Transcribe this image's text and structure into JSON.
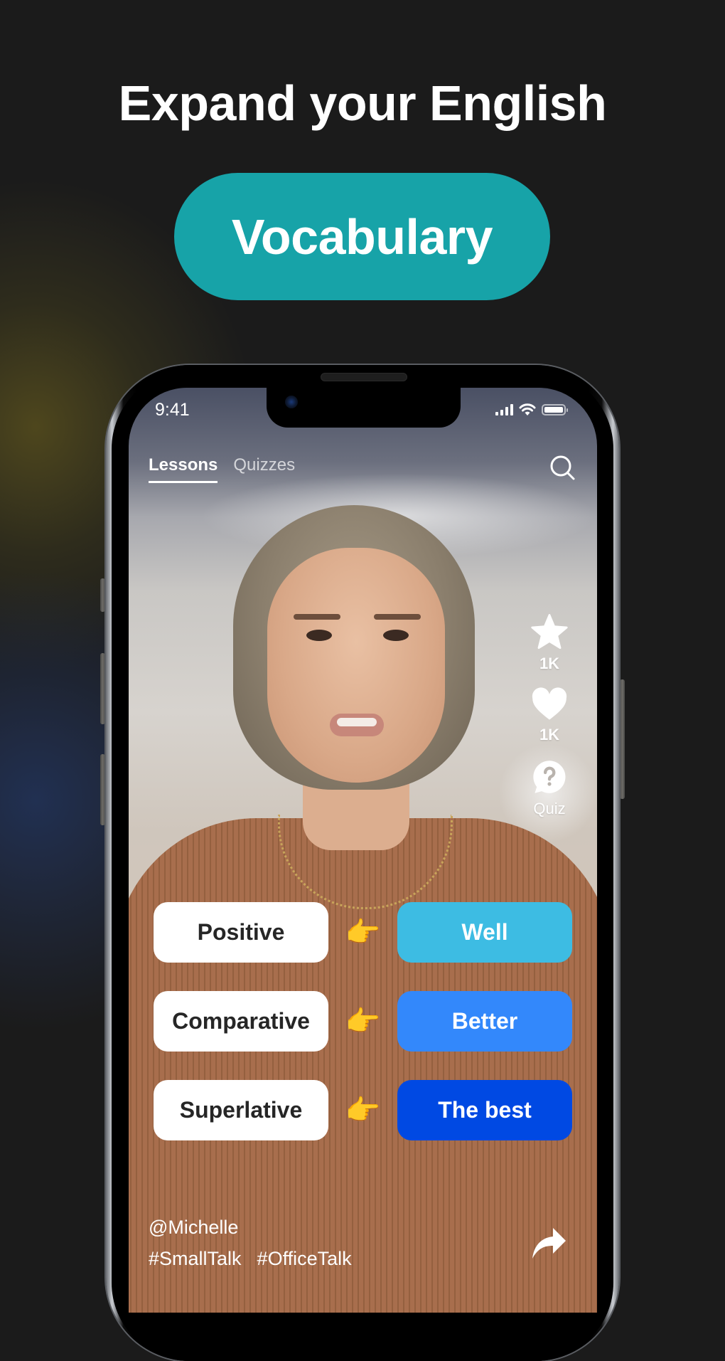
{
  "promo": {
    "headline": "Expand your English",
    "category_pill": "Vocabulary",
    "pill_color": "#17a3a8"
  },
  "status_bar": {
    "time": "9:41",
    "icons": [
      "cellular-signal-icon",
      "wifi-icon",
      "battery-icon"
    ]
  },
  "tabs": [
    {
      "label": "Lessons",
      "active": true
    },
    {
      "label": "Quizzes",
      "active": false
    }
  ],
  "search": {
    "icon": "search-icon"
  },
  "actions": [
    {
      "icon": "star-icon",
      "label": "1K"
    },
    {
      "icon": "heart-icon",
      "label": "1K"
    },
    {
      "icon": "quiz-bubble-icon",
      "label": "Quiz"
    }
  ],
  "vocab_rows": [
    {
      "form": "Positive",
      "pointer": "👉",
      "word": "Well",
      "color": "#3dbce3"
    },
    {
      "form": "Comparative",
      "pointer": "👉",
      "word": "Better",
      "color": "#3388fb"
    },
    {
      "form": "Superlative",
      "pointer": "👉",
      "word": "The best",
      "color": "#0049e3"
    }
  ],
  "video_info": {
    "username": "@Michelle",
    "hashtags": [
      "#SmallTalk",
      "#OfficeTalk"
    ]
  },
  "share": {
    "icon": "share-arrow-icon"
  }
}
